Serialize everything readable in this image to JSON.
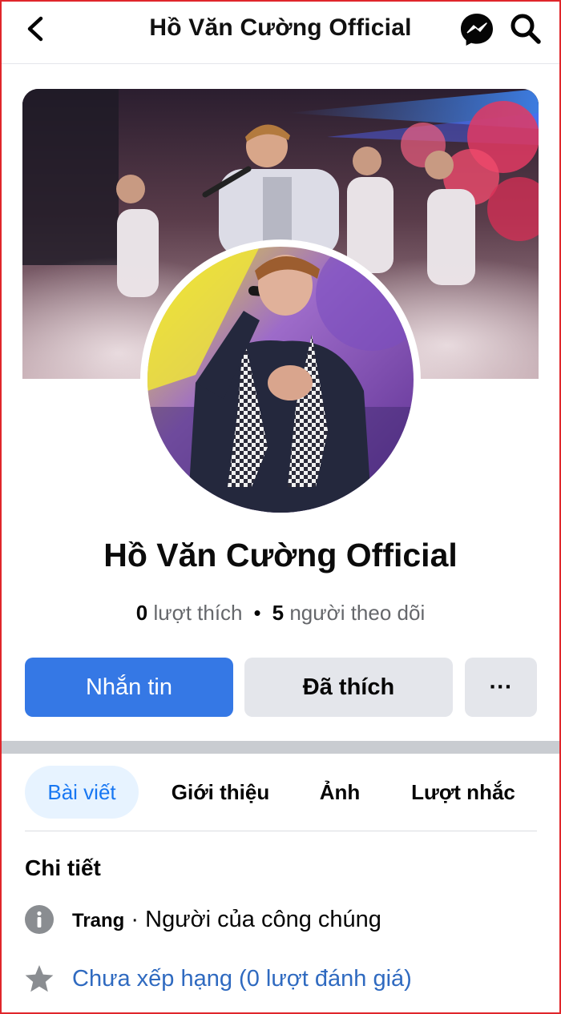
{
  "header": {
    "title": "Hồ Văn Cường Official",
    "icons": [
      "back-arrow-icon",
      "messenger-icon",
      "search-icon"
    ]
  },
  "profile": {
    "name": "Hồ Văn Cường Official",
    "likes_count": "0",
    "likes_label": "lượt thích",
    "followers_count": "5",
    "followers_label": "người theo dõi"
  },
  "actions": {
    "message_label": "Nhắn tin",
    "liked_label": "Đã thích",
    "more_label": "···"
  },
  "tabs": [
    {
      "label": "Bài viết",
      "active": true
    },
    {
      "label": "Giới thiệu",
      "active": false
    },
    {
      "label": "Ảnh",
      "active": false
    },
    {
      "label": "Lượt nhắc",
      "active": false
    }
  ],
  "details": {
    "title": "Chi tiết",
    "type_label": "Trang",
    "category": "Người của công chúng",
    "rating_text": "Chưa xếp hạng (0 lượt đánh giá)"
  },
  "colors": {
    "primary_button": "#3578e5",
    "secondary_button": "#e4e6eb",
    "active_tab_bg": "#e7f3ff",
    "active_tab_text": "#1877f2",
    "link": "#2f6ac0"
  }
}
